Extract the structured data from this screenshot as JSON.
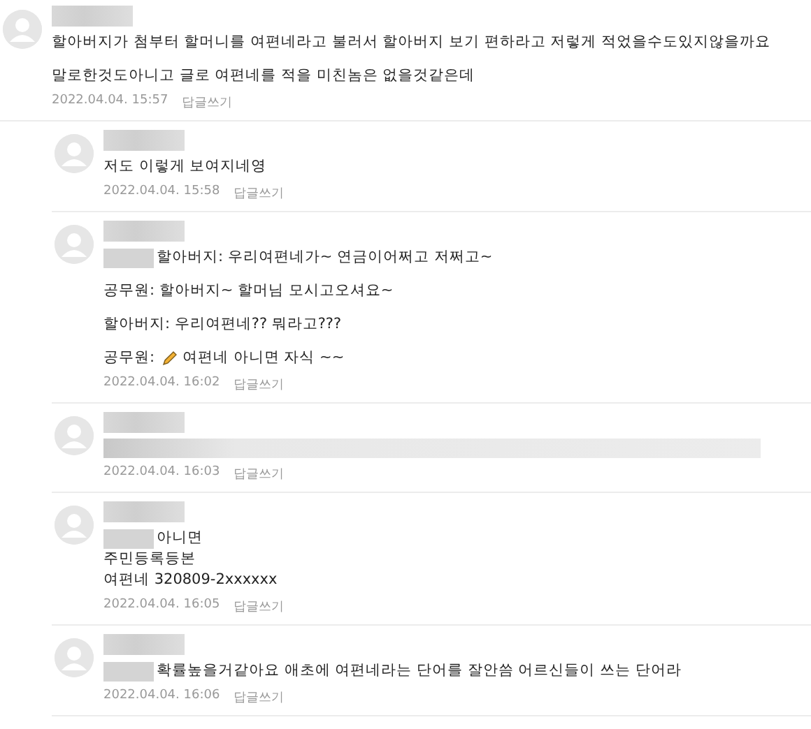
{
  "comments": [
    {
      "reply": false,
      "paragraphs": [
        [
          {
            "text": "할아버지가 첨부터 할머니를 여편네라고 불러서 할아버지 보기 편하라고 저렇게 적었을수도있지않을까요",
            "masked": false
          }
        ],
        [
          {
            "text": "말로한것도아니고 글로 여편네를 적을 미친놈은 없을것같은데",
            "masked": false
          }
        ]
      ],
      "date": "2022.04.04. 15:57",
      "reply_link": "답글쓰기"
    },
    {
      "reply": true,
      "paragraphs": [
        [
          {
            "text": "저도 이렇게 보여지네영",
            "masked": false
          }
        ]
      ],
      "date": "2022.04.04. 15:58",
      "reply_link": "답글쓰기"
    },
    {
      "reply": true,
      "paragraphs": [
        [
          {
            "text": "할아버지: 우리여편네가~ 연금이어쩌고 저쩌고~",
            "masked": true
          }
        ],
        [
          {
            "text": "공무원: 할아버지~ 할머님 모시고오셔요~",
            "masked": false
          }
        ],
        [
          {
            "text": "할아버지: 우리여편네?? 뭐라고???",
            "masked": false
          }
        ],
        [
          {
            "text": "공무원:",
            "masked": false,
            "pencil": true,
            "after": "여편네 아니면 자식 ~~"
          }
        ]
      ],
      "date": "2022.04.04. 16:02",
      "reply_link": "답글쓰기"
    },
    {
      "reply": true,
      "paragraphs": [
        [
          {
            "masked": true
          }
        ]
      ],
      "date": "2022.04.04. 16:03",
      "reply_link": "답글쓰기"
    },
    {
      "reply": true,
      "paragraphs": [
        [
          {
            "text": "아니면",
            "masked": true
          },
          {
            "text": "주민등록등본",
            "masked": false
          },
          {
            "text": "여편네 320809-2xxxxxx",
            "masked": false
          }
        ]
      ],
      "date": "2022.04.04. 16:05",
      "reply_link": "답글쓰기"
    },
    {
      "reply": true,
      "paragraphs": [
        [
          {
            "text": "확률높을거같아요 애초에 여편네라는 단어를 잘안씀 어르신들이 쓰는 단어라",
            "masked": true
          }
        ]
      ],
      "date": "2022.04.04. 16:06",
      "reply_link": "답글쓰기"
    }
  ]
}
